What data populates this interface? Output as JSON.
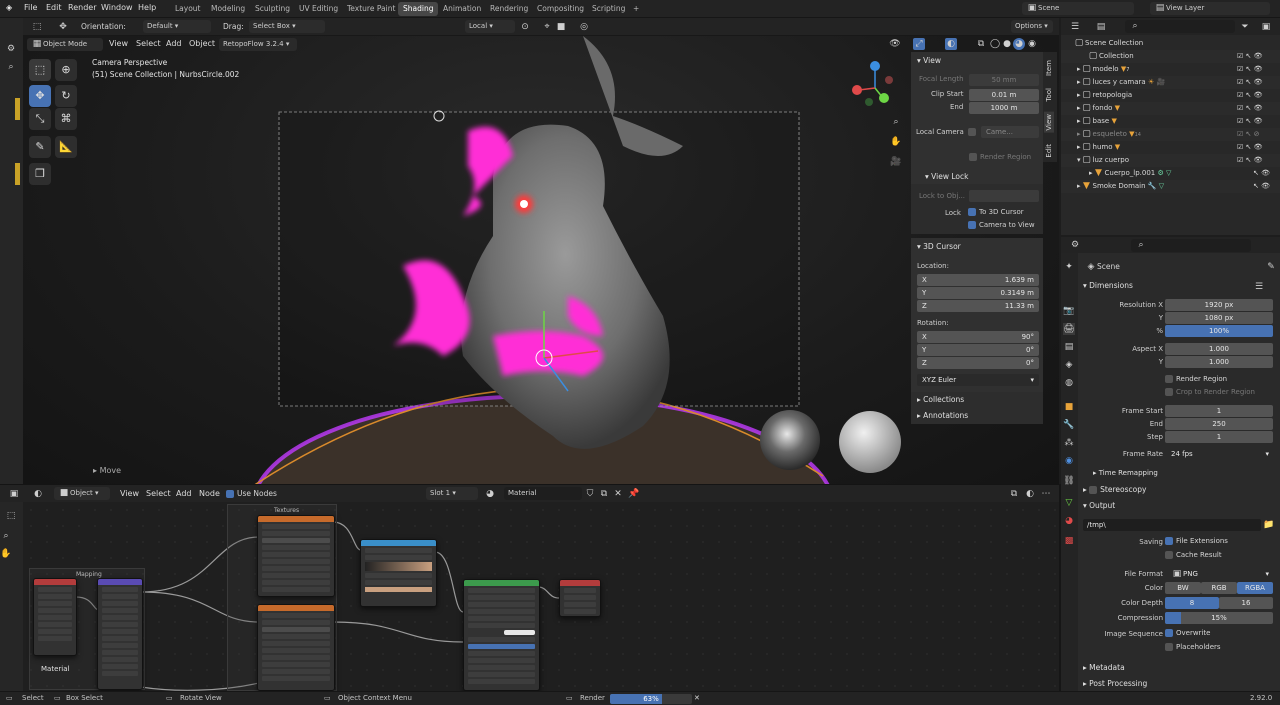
{
  "top_menu": {
    "items": [
      "File",
      "Edit",
      "Render",
      "Window",
      "Help"
    ],
    "workspaces": [
      "Layout",
      "Modeling",
      "Sculpting",
      "UV Editing",
      "Texture Paint",
      "Shading",
      "Animation",
      "Rendering",
      "Compositing",
      "Scripting"
    ],
    "active_workspace": "Shading",
    "add_tab": "+",
    "scene": "Scene",
    "view_layer": "View Layer"
  },
  "viewport_toolbar": {
    "orientation_label": "Orientation:",
    "orientation_value": "Default",
    "drag_label": "Drag:",
    "drag_value": "Select Box",
    "transform_space": "Local",
    "options": "Options"
  },
  "viewport_header": {
    "mode": "Object Mode",
    "menus": [
      "View",
      "Select",
      "Add",
      "Object"
    ],
    "addon": "RetopoFlow 3.2.4"
  },
  "viewport": {
    "camera_label": "Camera Perspective",
    "collection_label": "(51) Scene Collection | NurbsCircle.002",
    "move_label": "Move"
  },
  "n_panel": {
    "tabs": [
      "Item",
      "Tool",
      "View",
      "Edit"
    ],
    "view_section": "View",
    "focal_length_label": "Focal Length",
    "focal_length_value": "50 mm",
    "clip_start_label": "Clip Start",
    "clip_start_value": "0.01 m",
    "clip_end_label": "End",
    "clip_end_value": "1000 m",
    "local_camera_label": "Local Camera",
    "local_camera_value": "Came...",
    "render_region": "Render Region",
    "view_lock_section": "View Lock",
    "lock_to_obj": "Lock to Obj...",
    "lock_label": "Lock",
    "to_3d_cursor": "To 3D Cursor",
    "camera_to_view": "Camera to View",
    "cursor_section": "3D Cursor",
    "location_label": "Location:",
    "loc_x_label": "X",
    "loc_x": "1.639 m",
    "loc_y_label": "Y",
    "loc_y": "0.3149 m",
    "loc_z_label": "Z",
    "loc_z": "11.33 m",
    "rotation_label": "Rotation:",
    "rot_x_label": "X",
    "rot_x": "90°",
    "rot_y_label": "Y",
    "rot_y": "0°",
    "rot_z_label": "Z",
    "rot_z": "0°",
    "rotation_mode": "XYZ Euler",
    "collections_section": "Collections",
    "annotations_section": "Annotations"
  },
  "outliner": {
    "root": "Scene Collection",
    "items": [
      "Collection",
      "modelo",
      "luces y camara",
      "retopologia",
      "fondo",
      "base",
      "esqueleto",
      "humo",
      "luz cuerpo",
      "Cuerpo_lp.001",
      "Smoke Domain"
    ],
    "modelo_count": "7",
    "esqueleto_count": "14"
  },
  "properties": {
    "scene": "Scene",
    "dimensions_section": "Dimensions",
    "res_x_label": "Resolution X",
    "res_x": "1920 px",
    "res_y_label": "Y",
    "res_y": "1080 px",
    "res_pct_label": "%",
    "res_pct": "100%",
    "aspect_x_label": "Aspect X",
    "aspect_x": "1.000",
    "aspect_y_label": "Y",
    "aspect_y": "1.000",
    "render_region": "Render Region",
    "crop_region": "Crop to Render Region",
    "frame_start_label": "Frame Start",
    "frame_start": "1",
    "frame_end_label": "End",
    "frame_end": "250",
    "frame_step_label": "Step",
    "frame_step": "1",
    "frame_rate_label": "Frame Rate",
    "frame_rate": "24 fps",
    "time_remapping": "Time Remapping",
    "stereoscopy": "Stereoscopy",
    "output_section": "Output",
    "output_path": "/tmp\\",
    "saving_label": "Saving",
    "file_extensions": "File Extensions",
    "cache_result": "Cache Result",
    "file_format_label": "File Format",
    "file_format": "PNG",
    "color_label": "Color",
    "color_options": [
      "BW",
      "RGB",
      "RGBA"
    ],
    "color_selected": "RGBA",
    "color_depth_label": "Color Depth",
    "depth_options": [
      "8",
      "16"
    ],
    "depth_selected": "8",
    "compression_label": "Compression",
    "compression": "15%",
    "compression_fraction": 0.15,
    "image_sequence_label": "Image Sequence",
    "overwrite": "Overwrite",
    "placeholders": "Placeholders",
    "metadata": "Metadata",
    "post_processing": "Post Processing"
  },
  "node_editor": {
    "editor": "Object",
    "menus": [
      "View",
      "Select",
      "Add",
      "Node"
    ],
    "use_nodes": "Use Nodes",
    "slot": "Slot 1",
    "material": "Material",
    "frame_mapping": "Mapping",
    "frame_textures": "Textures",
    "material_label": "Material"
  },
  "status_bar": {
    "select": "Select",
    "box_select": "Box Select",
    "rotate_view": "Rotate View",
    "context_menu": "Object Context Menu",
    "render_label": "Render",
    "render_progress": "63%",
    "render_fraction": 0.63,
    "version": "2.92.0"
  },
  "colors": {
    "accent": "#4772b3",
    "glow": "#ff2fd6",
    "header": "#232323",
    "panel": "#303030"
  }
}
